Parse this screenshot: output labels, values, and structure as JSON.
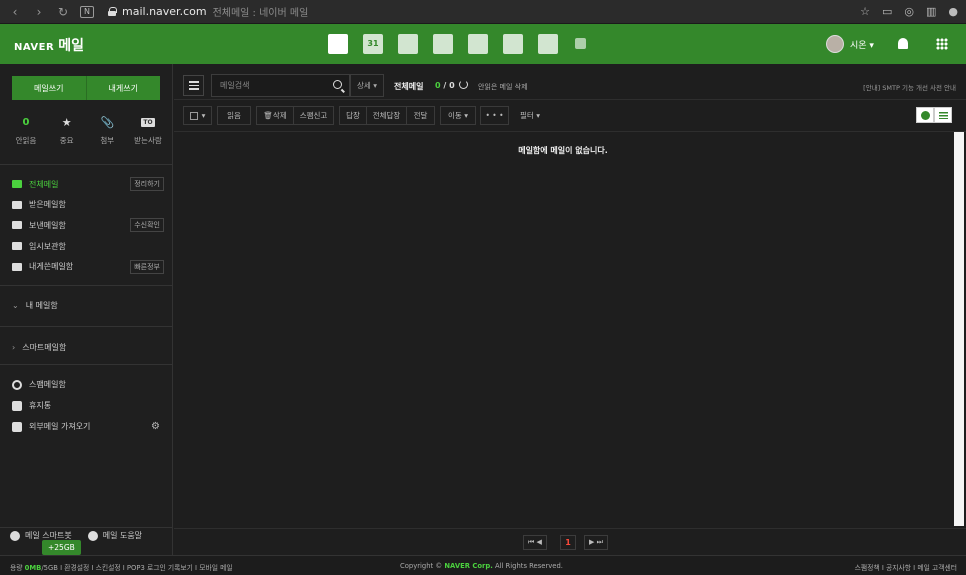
{
  "browser": {
    "host": "mail.naver.com",
    "tab_title": "전체메일 : 네이버 메일",
    "reader_icon": "N"
  },
  "header": {
    "logo_brand": "NAVER",
    "logo_service": "메일",
    "user_name": "시온 ▾",
    "apps": [
      "mail-app-icon",
      "calendar-app-icon",
      "memo-app-icon",
      "contacts-app-icon",
      "mybox-app-icon",
      "office-app-icon",
      "works-app-icon",
      "more-app-icon"
    ],
    "calendar_day": "31"
  },
  "sidebar": {
    "compose_label": "메일쓰기",
    "self_mail_label": "내게쓰기",
    "quick": [
      {
        "top": "0",
        "label": "안읽음"
      },
      {
        "top": "★",
        "label": "중요"
      },
      {
        "top": "📎",
        "label": "첨부"
      },
      {
        "top": "TO",
        "label": "받는사람"
      }
    ],
    "folders": [
      {
        "label": "전체메일",
        "tag": "정리하기"
      },
      {
        "label": "받은메일함",
        "tag": ""
      },
      {
        "label": "보낸메일함",
        "tag": "수신확인"
      },
      {
        "label": "임시보관함",
        "tag": ""
      },
      {
        "label": "내게쓴메일함",
        "tag": "빠른정부"
      }
    ],
    "my_mailbox": "내 메일함",
    "smart_mailbox": "스마트메일함",
    "tools": [
      {
        "label": "스팸메일함"
      },
      {
        "label": "휴지통"
      },
      {
        "label": "외부메일 가져오기"
      }
    ],
    "bottom_smart": "메일 스마트봇",
    "bottom_help": "메일 도움말",
    "storage_pill": "+25GB"
  },
  "main": {
    "search_placeholder": "메일검색",
    "detail_label": "상세 ▾",
    "box_title": "전체메일",
    "count_unread": "0",
    "count_sep": " / ",
    "count_total": "0",
    "unread_delete": "안읽은 메일 삭제",
    "notice": "[안내] SMTP 기능 개선 사전 안내",
    "toolbar": {
      "read": "읽음",
      "delete": "삭제",
      "spam": "스팸신고",
      "reply": "답장",
      "reply_all": "전체답장",
      "forward": "전달",
      "move": "이동 ▾",
      "more": "• • •",
      "filter": "필터 ▾"
    },
    "empty_message": "메일함에 메일이 없습니다.",
    "pager": {
      "first_prev": "⏮ ◀",
      "current": "1",
      "next_last": "▶ ⏭"
    }
  },
  "footer": {
    "storage_label": "용량 ",
    "storage_used": "0MB",
    "storage_total": "/5GB",
    "links_left": " I  환경설정  I  스킨설정  I  POP3 로그인 기록보기  I  모바일 메일",
    "copyright_pre": "Copyright © ",
    "copyright_brand": "NAVER Corp.",
    "copyright_post": " All Rights Reserved.",
    "links_right": "스팸정책  I  공지사항  I  메일 고객센터"
  },
  "colors": {
    "brand_green": "#34882b",
    "accent_green": "#4bd13e",
    "page_number": "#ff4a3a"
  }
}
